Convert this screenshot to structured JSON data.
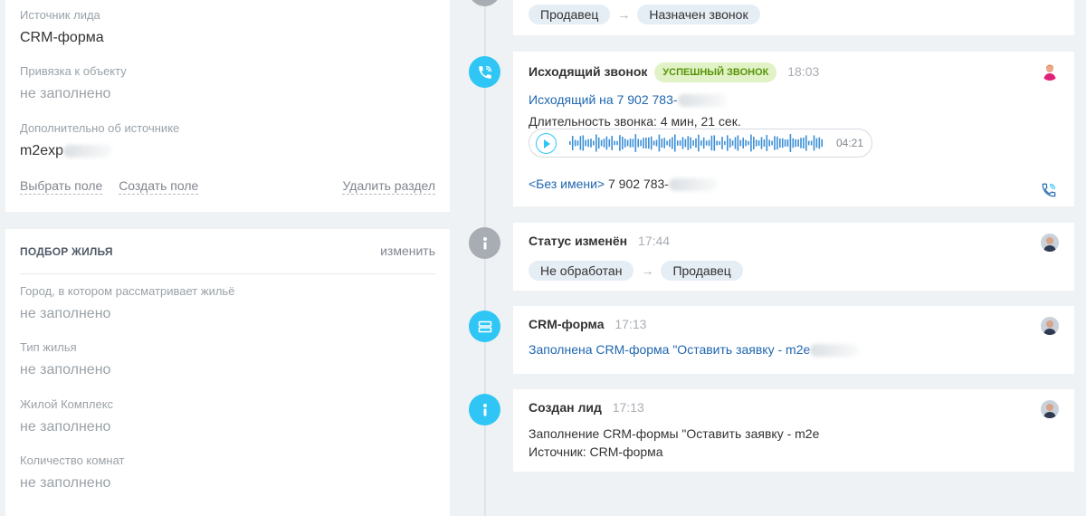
{
  "left": {
    "source_card": {
      "fields": [
        {
          "label": "Источник лида",
          "value": "CRM-форма"
        },
        {
          "label": "Привязка к объекту",
          "value": "не заполнено"
        },
        {
          "label": "Дополнительно об источнике",
          "value": "m2exp"
        }
      ],
      "actions": {
        "select_field": "Выбрать поле",
        "create_field": "Создать поле",
        "delete_section": "Удалить раздел"
      }
    },
    "housing_card": {
      "title": "ПОДБОР ЖИЛЬЯ",
      "edit": "изменить",
      "fields": [
        {
          "label": "Город, в котором рассматривает жильё",
          "value": "не заполнено"
        },
        {
          "label": "Тип жилья",
          "value": "не заполнено"
        },
        {
          "label": "Жилой Комплекс",
          "value": "не заполнено"
        },
        {
          "label": "Количество комнат",
          "value": "не заполнено"
        }
      ]
    }
  },
  "timeline": {
    "top_status": {
      "from": "Продавец",
      "to": "Назначен звонок",
      "arrow": "→"
    },
    "call": {
      "title": "Исходящий звонок",
      "badge": "успешный звонок",
      "time": "18:03",
      "number_line": "Исходящий на 7 902 783-",
      "duration_line": "Длительность звонка: 4 мин, 21 сек.",
      "player_duration": "04:21",
      "contact_name": "<Без имени>",
      "contact_number": " 7 902 783-"
    },
    "status_changed": {
      "title": "Статус изменён",
      "time": "17:44",
      "from": "Не обработан",
      "to": "Продавец",
      "arrow": "→"
    },
    "crm_form": {
      "title": "CRM-форма",
      "time": "17:13",
      "text": "Заполнена CRM-форма \"Оставить заявку - m2e"
    },
    "lead_created": {
      "title": "Создан лид",
      "time": "17:13",
      "line1": "Заполнение CRM-формы \"Оставить заявку - m2e",
      "line2": "Источник: CRM-форма"
    }
  },
  "colors": {
    "accent": "#2fc6f6",
    "link": "#2067b0",
    "badge_bg": "#e1f3c6",
    "badge_text": "#589309"
  }
}
